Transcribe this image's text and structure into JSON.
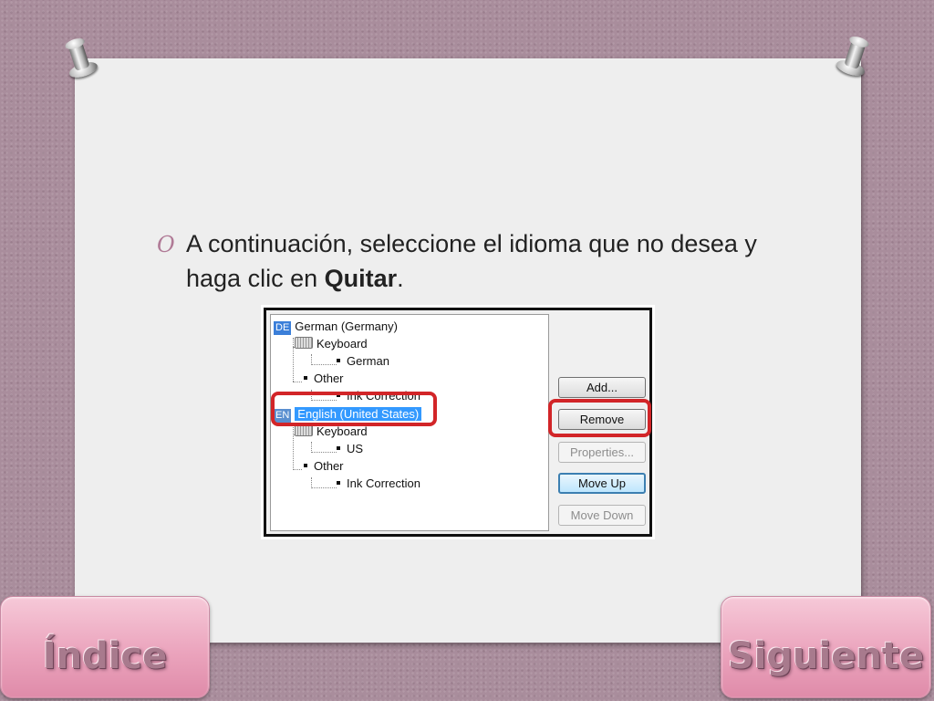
{
  "slide": {
    "bullet_glyph": "O",
    "text_part1": "A continuación, seleccione el idioma que no desea y haga clic en ",
    "text_strong": "Quitar",
    "text_end": "."
  },
  "language_dialog": {
    "tree": {
      "german": {
        "code": "DE",
        "label": "German (Germany)"
      },
      "german_keyboard": "Keyboard",
      "german_keyboard_item": "German",
      "german_other": "Other",
      "german_other_item": "Ink Correction",
      "english": {
        "code": "EN",
        "label": "English (United States)"
      },
      "english_keyboard": "Keyboard",
      "english_keyboard_item": "US",
      "english_other": "Other",
      "english_other_item": "Ink Correction"
    },
    "buttons": {
      "add": "Add...",
      "remove": "Remove",
      "properties": "Properties...",
      "move_up": "Move Up",
      "move_down": "Move Down"
    }
  },
  "nav": {
    "index_label": "Índice",
    "next_label": "Siguiente"
  },
  "colors": {
    "highlight": "#d22528",
    "selection": "#3399ff",
    "nav_button": "#eba4bd",
    "bullet": "#b07a96"
  }
}
